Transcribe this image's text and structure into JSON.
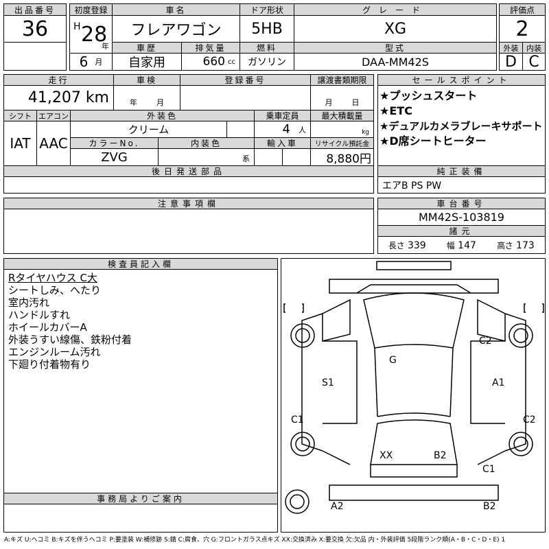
{
  "lot": {
    "label": "出品番号",
    "value": "36"
  },
  "first_reg": {
    "label": "初度登録",
    "era": "H",
    "year": "28",
    "year_unit": "年",
    "month": "6",
    "month_unit": "月"
  },
  "car_name": {
    "label": "車名",
    "value": "フレアワゴン"
  },
  "door": {
    "label": "ドア形状",
    "value": "5HB"
  },
  "grade": {
    "label": "グレード",
    "value": "XG"
  },
  "score": {
    "label": "評価点",
    "value": "2",
    "ext_label": "外装",
    "int_label": "内装",
    "ext": "D",
    "int": "C"
  },
  "history": {
    "label": "車歴",
    "value": "自家用"
  },
  "displacement": {
    "label": "排気量",
    "value": "660",
    "unit": "cc"
  },
  "fuel": {
    "label": "燃料",
    "value": "ガソリン"
  },
  "model": {
    "label": "型式",
    "value": "DAA-MM42S"
  },
  "mileage": {
    "label": "走行",
    "value": "41,207 km"
  },
  "inspection": {
    "label": "車検",
    "year_unit": "年",
    "month_unit": "月"
  },
  "reg_number": {
    "label": "登録番号"
  },
  "transfer": {
    "label": "譲渡書類期限",
    "month_unit": "月",
    "day_unit": "日"
  },
  "shift": {
    "label": "シフト",
    "value": "IAT"
  },
  "aircon": {
    "label": "エアコン",
    "value": "AAC"
  },
  "ext_color": {
    "label": "外装色",
    "value": "クリーム"
  },
  "capacity": {
    "label": "乗車定員",
    "value": "4",
    "unit": "人"
  },
  "max_load": {
    "label": "最大積載量",
    "unit": "kg"
  },
  "color_no": {
    "label": "カラーNo.",
    "value": "ZVG"
  },
  "int_color": {
    "label": "内装色",
    "unit": "系"
  },
  "import": {
    "label": "輸入車"
  },
  "recycle": {
    "label": "リサイクル預託金",
    "value": "8,880円"
  },
  "later_parts": {
    "label": "後日発送部品"
  },
  "sales_points": {
    "label": "セールスポイント",
    "items": [
      "★プッシュスタート",
      "★ETC",
      "★デュアルカメラブレーキサポート",
      "★D席シートヒーター"
    ]
  },
  "equipment": {
    "label": "純正装備",
    "value": "エアB PS PW"
  },
  "notes": {
    "label": "注意事項欄"
  },
  "chassis": {
    "label": "車台番号",
    "value": "MM42S-103819"
  },
  "specs": {
    "label": "諸元",
    "length_label": "長さ",
    "length": "339",
    "width_label": "幅",
    "width": "147",
    "height_label": "高さ",
    "height": "173"
  },
  "inspector": {
    "label": "検査員記入欄",
    "lines": [
      "Rタイヤハウス C大",
      "シートしみ、へたり",
      "室内汚れ",
      "ハンドルすれ",
      "ホイールカバーA",
      "外装うすい線傷、鉄粉付着",
      "エンジンルーム汚れ",
      "下廻り付着物有り"
    ]
  },
  "office": {
    "label": "事務局よりご案内"
  },
  "diagram_marks": {
    "s1": "S1",
    "a1": "A1",
    "g": "G",
    "c2_front": "C2",
    "c1_left": "C1",
    "c2_right": "C2",
    "xx": "XX",
    "b2_rear": "B2",
    "c1_rear": "C1",
    "a2": "A2",
    "b2_bumper": "B2"
  },
  "legend": "A:キズ U:ヘコミ B:キズを伴うヘコミ P:要塗装 W:補修跡 S:錆 C:腐食、穴 G:フロントガラス点キズ XX:交換済み X:要交換 欠:欠品 内・外装評価 5段階ランク順(A・B・C・D・E) 1"
}
